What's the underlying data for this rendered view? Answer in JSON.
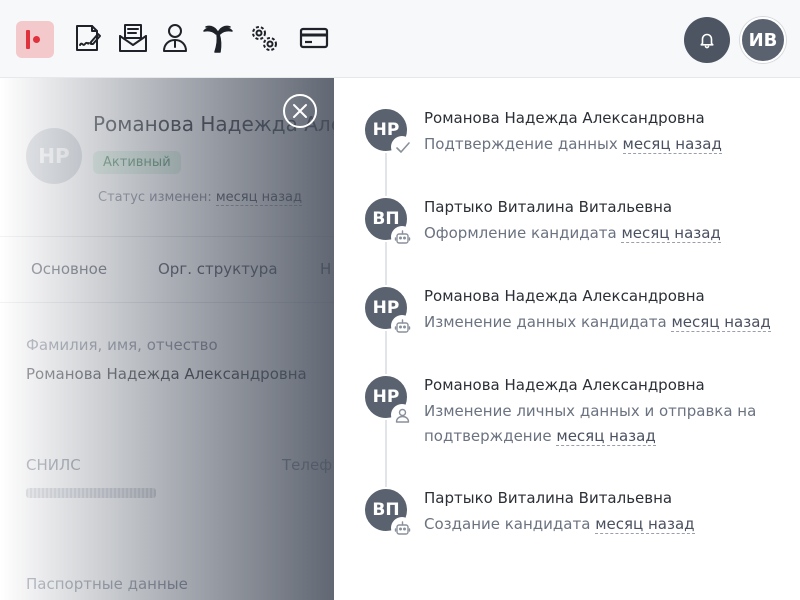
{
  "header": {
    "nav_icons": [
      "app-logo-icon",
      "signature-document-icon",
      "mail-inbox-icon",
      "employee-icon",
      "palm-tree-icon",
      "settings-gears-icon",
      "payment-card-icon"
    ],
    "notification_icon": "bell-icon",
    "user_initials": "ИВ"
  },
  "profile": {
    "initials": "НР",
    "name": "Романова Надежда Алекс",
    "status_badge": "Активный",
    "status_changed_label": "Статус изменен:",
    "status_changed_ago": "месяц назад",
    "tabs": [
      "Основное",
      "Орг. структура",
      "Н"
    ],
    "fields": {
      "fio_label": "Фамилия, имя, отчество",
      "fio_value": "Романова Надежда Александровна",
      "snils_label": "СНИЛС",
      "phone_label": "Телеф",
      "passport_label": "Паспортные данные"
    }
  },
  "activity": {
    "close_icon": "close-circle-icon",
    "items": [
      {
        "initials": "НР",
        "badge_icon": "check-icon",
        "name": "Романова Надежда Александровна",
        "action": "Подтверждение данных",
        "ago": "месяц назад"
      },
      {
        "initials": "ВП",
        "badge_icon": "robot-icon",
        "name": "Партыко Виталина Витальевна",
        "action": "Оформление кандидата",
        "ago": "месяц назад"
      },
      {
        "initials": "НР",
        "badge_icon": "robot-icon",
        "name": "Романова Надежда Александровна",
        "action": "Изменение данных кандидата",
        "ago": "месяц назад"
      },
      {
        "initials": "НР",
        "badge_icon": "person-icon",
        "name": "Романова Надежда Александровна",
        "action": "Изменение личных данных и отправка на подтверждение",
        "ago": "месяц назад"
      },
      {
        "initials": "ВП",
        "badge_icon": "robot-icon",
        "name": "Партыко Виталина Витальевна",
        "action": "Создание кандидата",
        "ago": "месяц назад"
      }
    ]
  },
  "colors": {
    "brand": "#e0323c",
    "avatar": "#5a6270",
    "success_badge_bg": "#dff3e6"
  }
}
